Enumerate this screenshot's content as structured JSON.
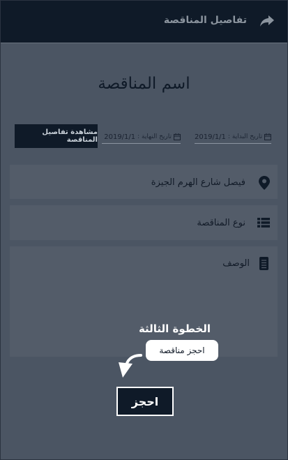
{
  "header": {
    "title": "تفاصيل المناقصة",
    "back_icon": "share-arrow-icon"
  },
  "tender": {
    "name": "اسم المناقصة",
    "start_date_label": "تاريخ البداية :",
    "start_date_value": "2019/1/1",
    "end_date_label": "تاريخ النهاية :",
    "end_date_value": "2019/1/1",
    "view_details_label": "مشاهدة تفاصيل المناقصة"
  },
  "fields": {
    "location": "فيصل شارع الهرم الجيزة",
    "type": "نوع المناقصة",
    "description": "الوصف"
  },
  "tutorial": {
    "step_title": "الخطوة الثالثة",
    "tooltip": "احجز مناقصة"
  },
  "actions": {
    "book_label": "احجز"
  },
  "colors": {
    "header_bg": "#0f1a28",
    "page_bg": "#4b5563",
    "field_bg": "#535c69",
    "accent": "#0f1a28"
  }
}
